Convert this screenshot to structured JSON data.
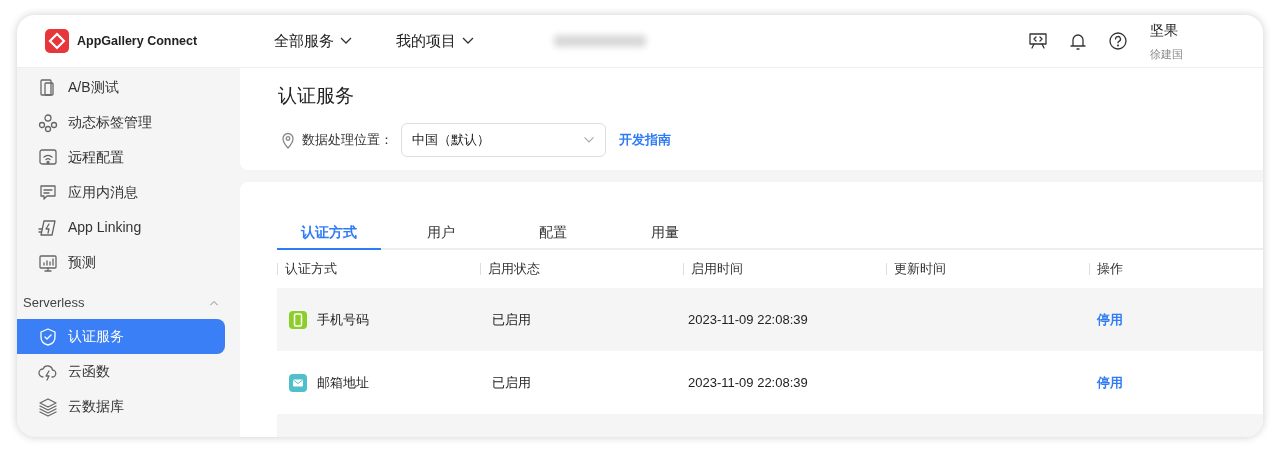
{
  "header": {
    "logo_text": "AppGallery Connect",
    "menus": [
      {
        "label": "全部服务"
      },
      {
        "label": "我的项目"
      }
    ],
    "user": {
      "name": "坚果",
      "subtitle": "徐建国"
    }
  },
  "sidebar": {
    "items": [
      {
        "label": "A/B测试",
        "kind": "ab",
        "selected": false
      },
      {
        "label": "动态标签管理",
        "kind": "nodes",
        "selected": false
      },
      {
        "label": "远程配置",
        "kind": "wifi",
        "selected": false
      },
      {
        "label": "应用内消息",
        "kind": "message",
        "selected": false
      },
      {
        "label": "App Linking",
        "kind": "link",
        "selected": false
      },
      {
        "label": "预测",
        "kind": "chart",
        "selected": false
      }
    ],
    "section": {
      "label": "Serverless",
      "expanded": true,
      "items": [
        {
          "label": "认证服务",
          "kind": "shield",
          "selected": true
        },
        {
          "label": "云函数",
          "kind": "cloud",
          "selected": false
        },
        {
          "label": "云数据库",
          "kind": "layers",
          "selected": false
        }
      ]
    }
  },
  "page": {
    "title": "认证服务",
    "location_label": "数据处理位置：",
    "location_value": "中国（默认）",
    "guide_link": "开发指南"
  },
  "tabs": [
    {
      "label": "认证方式",
      "selected": true
    },
    {
      "label": "用户",
      "selected": false
    },
    {
      "label": "配置",
      "selected": false
    },
    {
      "label": "用量",
      "selected": false
    }
  ],
  "table": {
    "columns": [
      "认证方式",
      "启用状态",
      "启用时间",
      "更新时间",
      "操作"
    ],
    "rows": [
      {
        "kind": "phone",
        "method": "手机号码",
        "status": "已启用",
        "enabled_time": "2023-11-09 22:08:39",
        "action": "停用"
      },
      {
        "kind": "email",
        "method": "邮箱地址",
        "status": "已启用",
        "enabled_time": "2023-11-09 22:08:39",
        "action": "停用"
      }
    ]
  }
}
